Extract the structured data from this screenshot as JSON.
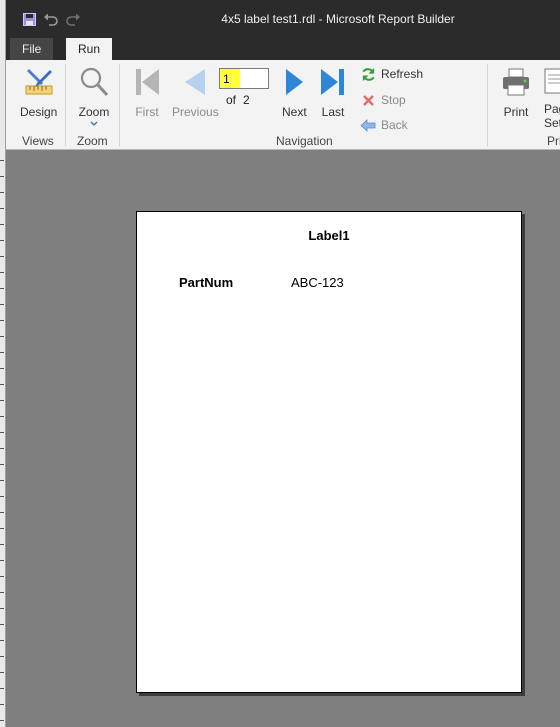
{
  "window": {
    "title": "4x5 label test1.rdl - Microsoft Report Builder"
  },
  "quick_access": {
    "save_icon": "save-icon",
    "undo_icon": "undo-icon",
    "redo_icon": "redo-icon"
  },
  "tabs": [
    {
      "label": "File",
      "active": false
    },
    {
      "label": "Run",
      "active": true
    }
  ],
  "ribbon": {
    "views": {
      "group_label": "Views",
      "design_label": "Design"
    },
    "zoom": {
      "group_label": "Zoom",
      "zoom_label": "Zoom"
    },
    "navigation": {
      "group_label": "Navigation",
      "first_label": "First",
      "previous_label": "Previous",
      "current_page": "1",
      "of_label": "of",
      "total_pages": "2",
      "next_label": "Next",
      "last_label": "Last",
      "refresh_label": "Refresh",
      "stop_label": "Stop",
      "back_label": "Back"
    },
    "print": {
      "group_label": "Pri",
      "print_label": "Print",
      "page_setup_label_1": "Pag",
      "page_setup_label_2": "Set"
    }
  },
  "report": {
    "title": "Label1",
    "field_label": "PartNum",
    "field_value": "ABC-123"
  },
  "colors": {
    "title_bar": "#2b2b2b",
    "ribbon": "#f3f3f3",
    "workspace": "#7f7f7f",
    "nav_blue": "#2e86d6",
    "page_highlight": "#ffff3a"
  }
}
